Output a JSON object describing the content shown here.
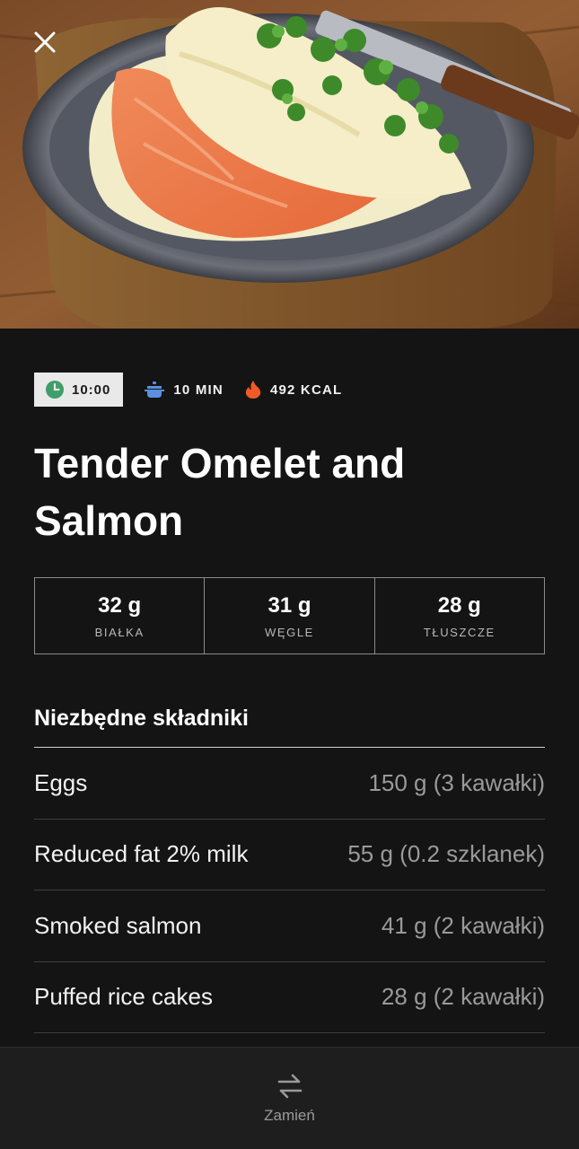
{
  "hero": {
    "image_alt": "Omelet with smoked salmon and greens on a plate"
  },
  "header": {
    "close_icon": "close-icon"
  },
  "meta": {
    "time": "10:00",
    "time_icon": "clock-icon",
    "duration": "10 MIN",
    "duration_icon": "pot-icon",
    "calories": "492 KCAL",
    "calories_icon": "flame-icon"
  },
  "recipe": {
    "title": "Tender Omelet and Salmon"
  },
  "macros": [
    {
      "value": "32 g",
      "label": "BIAŁKA"
    },
    {
      "value": "31 g",
      "label": "WĘGLE"
    },
    {
      "value": "28 g",
      "label": "TŁUSZCZE"
    }
  ],
  "ingredients": {
    "title": "Niezbędne składniki",
    "items": [
      {
        "name": "Eggs",
        "amount": "150 g (3 kawałki)"
      },
      {
        "name": "Reduced fat 2% milk",
        "amount": "55 g (0.2 szklanek)"
      },
      {
        "name": "Smoked salmon",
        "amount": "41 g (2 kawałki)"
      },
      {
        "name": "Puffed rice cakes",
        "amount": "28 g (2 kawałki)"
      }
    ]
  },
  "bottom": {
    "swap_label": "Zamień",
    "swap_icon": "swap-arrows-icon"
  },
  "colors": {
    "background": "#141414",
    "clock_green": "#3f9e6a",
    "pot_blue": "#5b8fe0",
    "flame_orange": "#f05a28"
  }
}
